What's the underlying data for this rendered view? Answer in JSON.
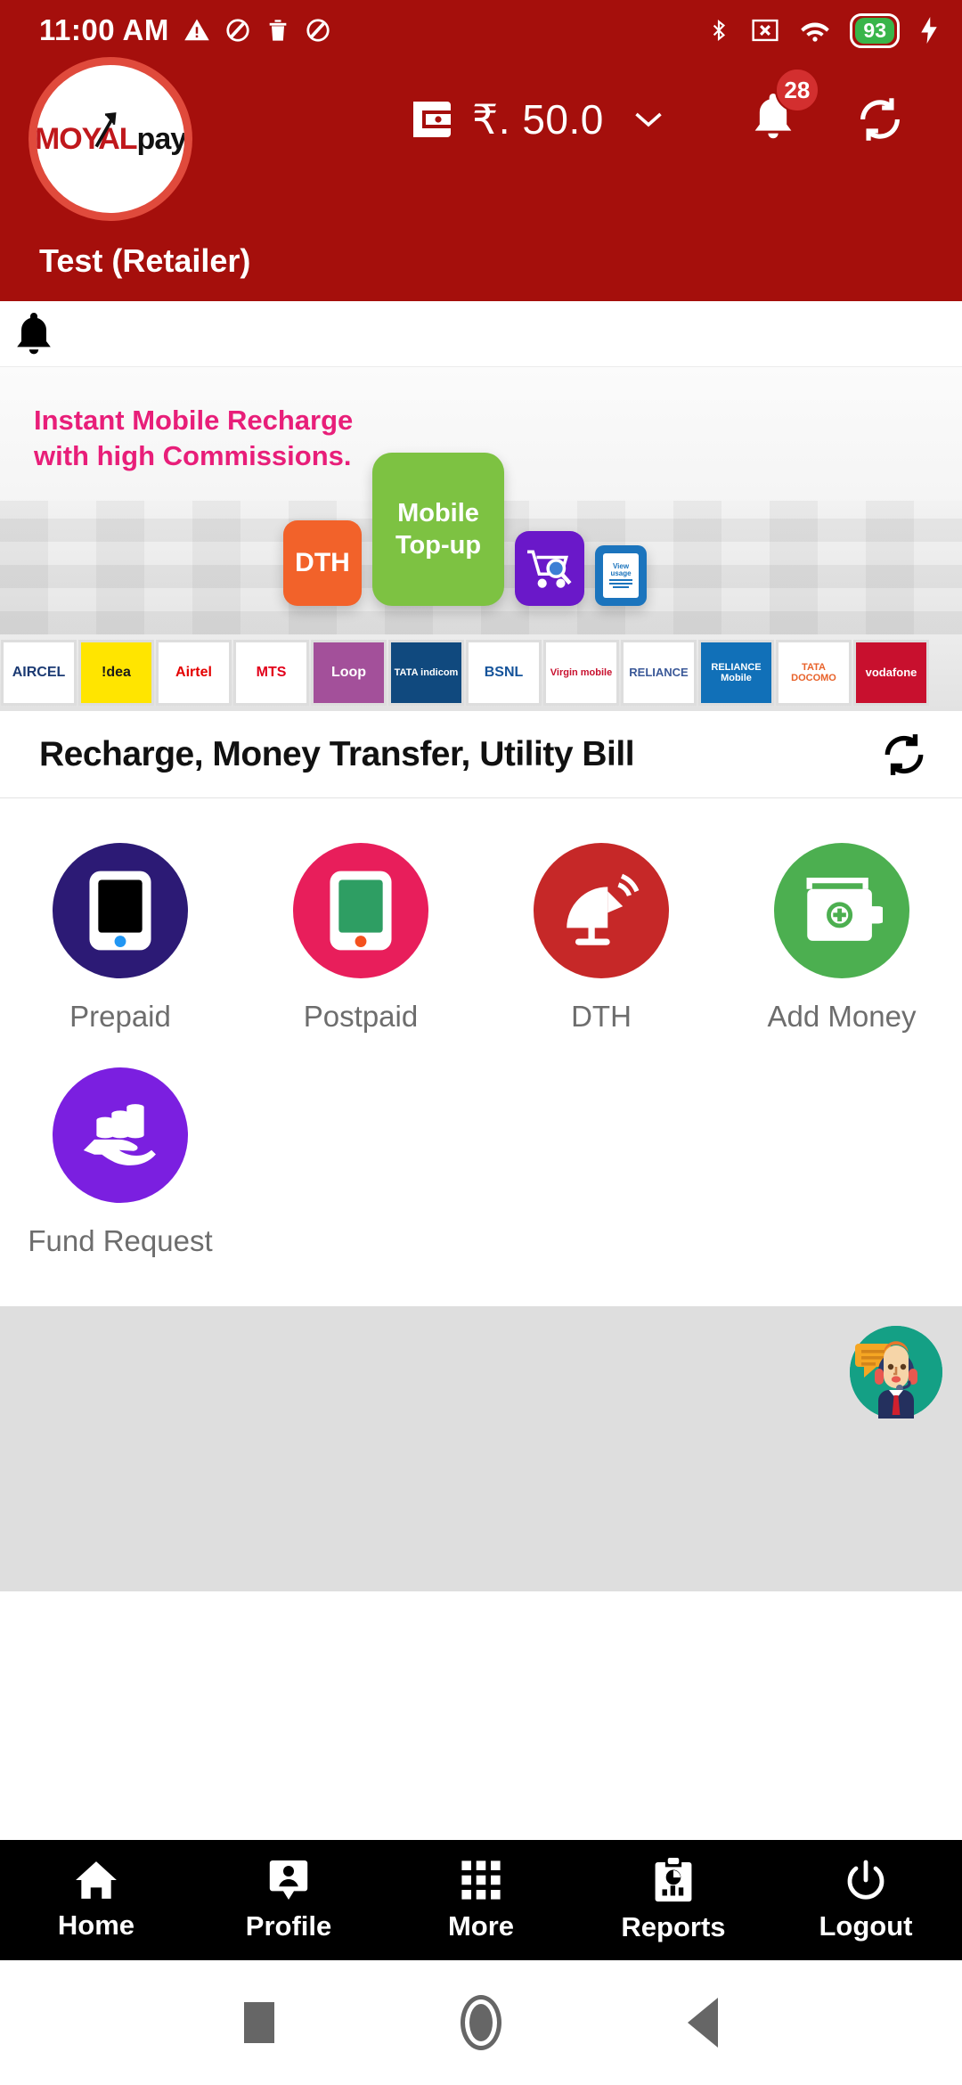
{
  "status_bar": {
    "time": "11:00 AM",
    "left_icons": [
      "warning-triangle-icon",
      "block-icon",
      "trash-icon",
      "block-icon"
    ],
    "right_icons": [
      "bluetooth-icon",
      "sim-x-icon",
      "wifi-icon"
    ],
    "battery_percent": "93",
    "charging": true
  },
  "header": {
    "logo": {
      "part1": "MO",
      "part2": "YAL",
      "part3": "pay"
    },
    "wallet": {
      "icon": "wallet-icon",
      "amount": "₹. 50.0",
      "chevron": "chevron-down-icon"
    },
    "notification_badge": "28",
    "refresh_icon": "refresh-icon",
    "retailer_name": "Test (Retailer)",
    "bg_color": "#A50F0C"
  },
  "notification_strip": {
    "icon": "bell-icon"
  },
  "banner": {
    "title_line1": "Instant Mobile Recharge",
    "title_line2": "with high Commissions.",
    "title_color": "#E81E79",
    "tiles": [
      {
        "label": "DTH",
        "color": "#F2622A"
      },
      {
        "label": "Mobile Top-up",
        "color": "#7DC242"
      },
      {
        "label": "",
        "icon": "shopping-cart-search-icon",
        "color": "#6A18C9"
      },
      {
        "label": "View usage",
        "color": "#1B74BD"
      }
    ],
    "operators": [
      {
        "name": "AIRCEL",
        "bg": "#ffffff",
        "fg": "#1B3A73"
      },
      {
        "name": "!dea",
        "bg": "#FFE500",
        "fg": "#1a1a1a"
      },
      {
        "name": "Airtel",
        "bg": "#ffffff",
        "fg": "#E40000"
      },
      {
        "name": "MTS",
        "bg": "#ffffff",
        "fg": "#E2001A"
      },
      {
        "name": "Loop",
        "bg": "#A3509A",
        "fg": "#ffffff"
      },
      {
        "name": "TATA indicom",
        "bg": "#10497E",
        "fg": "#ffffff"
      },
      {
        "name": "BSNL",
        "bg": "#ffffff",
        "fg": "#14539A"
      },
      {
        "name": "Virgin mobile",
        "bg": "#ffffff",
        "fg": "#C8102E"
      },
      {
        "name": "RELIANCE",
        "bg": "#ffffff",
        "fg": "#3B5998"
      },
      {
        "name": "RELIANCE Mobile",
        "bg": "#1170B8",
        "fg": "#ffffff"
      },
      {
        "name": "TATA DOCOMO",
        "bg": "#ffffff",
        "fg": "#E8622A"
      },
      {
        "name": "vodafone",
        "bg": "#C8102E",
        "fg": "#ffffff"
      }
    ]
  },
  "section": {
    "title": "Recharge, Money Transfer, Utility Bill",
    "refresh_icon": "refresh-icon"
  },
  "services": [
    {
      "label": "Prepaid",
      "icon": "mobile-phone-icon",
      "circle": "#2C1A75",
      "accent": "#2196F3",
      "screen": "#000000"
    },
    {
      "label": "Postpaid",
      "icon": "mobile-phone-icon",
      "circle": "#E81E5B",
      "accent": "#F4511E",
      "screen": "#2E9E63"
    },
    {
      "label": "DTH",
      "icon": "satellite-dish-icon",
      "circle": "#C62828",
      "accent": "#ffffff",
      "screen": "#ffffff"
    },
    {
      "label": "Add Money",
      "icon": "wallet-plus-icon",
      "circle": "#4CAF50",
      "accent": "#ffffff",
      "screen": "#ffffff"
    },
    {
      "label": "Fund Request",
      "icon": "hand-coins-icon",
      "circle": "#7B1FE0",
      "accent": "#ffffff",
      "screen": "#ffffff"
    }
  ],
  "support": {
    "icon": "customer-support-agent-icon",
    "bg": "#14A085"
  },
  "bottom_nav": [
    {
      "label": "Home",
      "icon": "home-icon"
    },
    {
      "label": "Profile",
      "icon": "profile-person-icon"
    },
    {
      "label": "More",
      "icon": "grid-dots-icon"
    },
    {
      "label": "Reports",
      "icon": "clipboard-chart-icon"
    },
    {
      "label": "Logout",
      "icon": "power-icon"
    }
  ],
  "android_nav": [
    {
      "icon": "recents-square-icon"
    },
    {
      "icon": "home-circle-icon"
    },
    {
      "icon": "back-triangle-icon"
    }
  ]
}
